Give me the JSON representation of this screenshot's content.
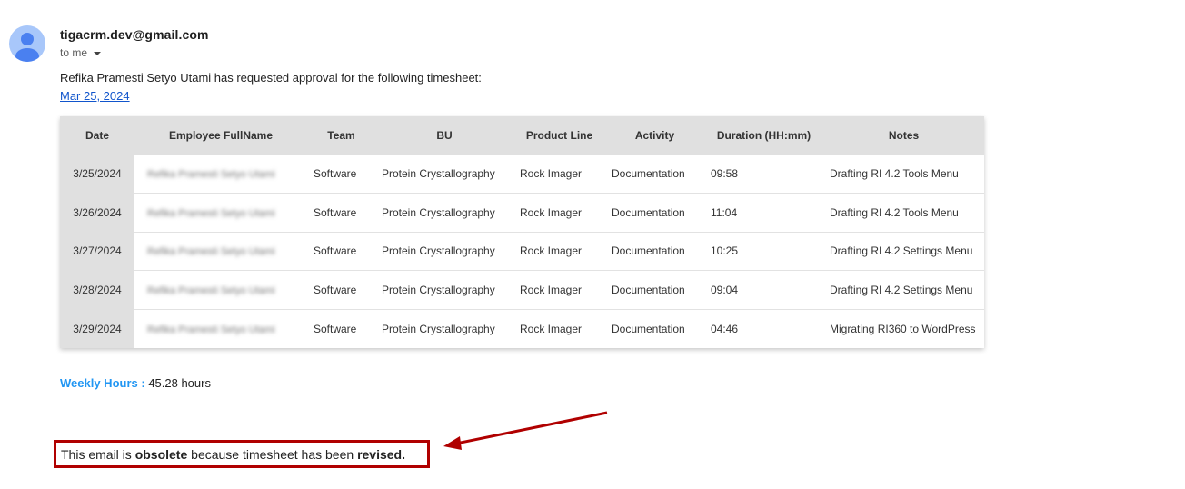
{
  "email": {
    "sender": "tigacrm.dev@gmail.com",
    "recipient_label": "to me",
    "intro": "Refika Pramesti Setyo Utami has requested approval for the following timesheet:",
    "date_link": "Mar 25, 2024"
  },
  "table": {
    "headers": [
      "Date",
      "Employee FullName",
      "Team",
      "BU",
      "Product Line",
      "Activity",
      "Duration (HH:mm)",
      "Notes"
    ],
    "rows": [
      {
        "date": "3/25/2024",
        "name": "Refika Pramesti Setyo Utami",
        "team": "Software",
        "bu": "Protein Crystallography",
        "product_line": "Rock Imager",
        "activity": "Documentation",
        "duration": "09:58",
        "notes": "Drafting RI 4.2 Tools Menu"
      },
      {
        "date": "3/26/2024",
        "name": "Refika Pramesti Setyo Utami",
        "team": "Software",
        "bu": "Protein Crystallography",
        "product_line": "Rock Imager",
        "activity": "Documentation",
        "duration": "11:04",
        "notes": "Drafting RI 4.2 Tools Menu"
      },
      {
        "date": "3/27/2024",
        "name": "Refika Pramesti Setyo Utami",
        "team": "Software",
        "bu": "Protein Crystallography",
        "product_line": "Rock Imager",
        "activity": "Documentation",
        "duration": "10:25",
        "notes": "Drafting RI 4.2 Settings Menu"
      },
      {
        "date": "3/28/2024",
        "name": "Refika Pramesti Setyo Utami",
        "team": "Software",
        "bu": "Protein Crystallography",
        "product_line": "Rock Imager",
        "activity": "Documentation",
        "duration": "09:04",
        "notes": "Drafting RI 4.2 Settings Menu"
      },
      {
        "date": "3/29/2024",
        "name": "Refika Pramesti Setyo Utami",
        "team": "Software",
        "bu": "Protein Crystallography",
        "product_line": "Rock Imager",
        "activity": "Documentation",
        "duration": "04:46",
        "notes": "Migrating RI360 to WordPress"
      }
    ]
  },
  "weekly": {
    "label": "Weekly Hours :",
    "value": "45.28 hours"
  },
  "notice": {
    "prefix": "This email is ",
    "obsolete": "obsolete",
    "middle": " because timesheet has been ",
    "revised": "revised."
  },
  "colors": {
    "link": "#1155cc",
    "weekly_label": "#2196f3",
    "notice_border": "#b00000",
    "header_bg": "#e0e0e0",
    "avatar_bg": "#a8c7fa",
    "avatar_figure": "#4a80f0"
  },
  "icons": {
    "avatar": "person-icon",
    "recipient_caret": "caret-down-icon",
    "annotation": "arrow-icon"
  }
}
